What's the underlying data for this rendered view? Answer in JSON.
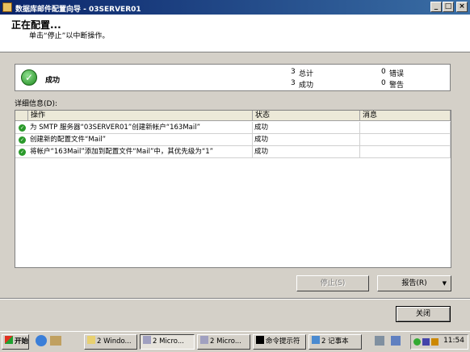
{
  "window": {
    "title": "数据库邮件配置向导 - 03SERVER01",
    "header_title": "正在配置...",
    "header_subtitle": "单击“停止”以中断操作。"
  },
  "status": {
    "result_text": "成功",
    "total_count": "3",
    "total_label": "总计",
    "success_count": "3",
    "success_label": "成功",
    "error_count": "0",
    "error_label": "错误",
    "warning_count": "0",
    "warning_label": "警告"
  },
  "details": {
    "label": "详细信息(D):",
    "columns": [
      "操作",
      "状态",
      "消息"
    ],
    "rows": [
      {
        "action": "为 SMTP 服务器“03SERVER01”创建新帐户“163Mail”",
        "status": "成功",
        "message": ""
      },
      {
        "action": "创建新的配置文件“Mail”",
        "status": "成功",
        "message": ""
      },
      {
        "action": "将帐户“163Mail”添加到配置文件“Mail”中，其优先级为“1”",
        "status": "成功",
        "message": ""
      }
    ]
  },
  "buttons": {
    "stop": "停止(S)",
    "report": "报告(R)",
    "close": "关闭"
  },
  "taskbar": {
    "start": "开始",
    "tasks": [
      {
        "label": "2 Windo..."
      },
      {
        "label": "2 Micro..."
      },
      {
        "label": "2 Micro..."
      },
      {
        "label": "命令提示符"
      },
      {
        "label": "2 记事本"
      }
    ],
    "clock": "11:54"
  }
}
